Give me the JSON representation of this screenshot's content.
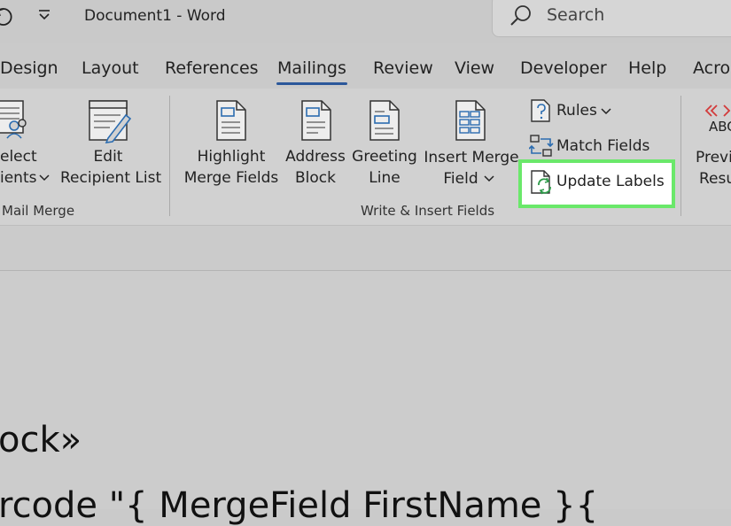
{
  "title_bar": {
    "document_title": "Document1  -  Word",
    "search_placeholder": "Search"
  },
  "tabs": [
    "Design",
    "Layout",
    "References",
    "Mailings",
    "Review",
    "View",
    "Developer",
    "Help",
    "Acro"
  ],
  "active_tab": "Mailings",
  "ribbon": {
    "select_recipients": {
      "line1": "elect",
      "line2": "ients"
    },
    "edit_recipient_list": {
      "line1": "Edit",
      "line2": "Recipient List"
    },
    "start_group_label": "Mail Merge",
    "highlight_merge_fields": {
      "line1": "Highlight",
      "line2": "Merge Fields"
    },
    "address_block": {
      "line1": "Address",
      "line2": "Block"
    },
    "greeting_line": {
      "line1": "Greeting",
      "line2": "Line"
    },
    "insert_merge_field": {
      "line1": "Insert Merge",
      "line2": "Field"
    },
    "rules": "Rules",
    "match_fields": "Match Fields",
    "update_labels": "Update Labels",
    "write_group_label": "Write & Insert Fields",
    "preview_results": {
      "line1": "Previ",
      "line2": "Resu",
      "abc": "ABC"
    }
  },
  "document": {
    "line1": "ock»",
    "line2": "rcode \"{ MergeField FirstName }{"
  },
  "colors": {
    "accent": "#2b579a",
    "highlight": "#6ae86a",
    "icon_blue": "#2b6cb0",
    "icon_green": "#2e9b4a",
    "preview_red": "#d33b3b"
  }
}
